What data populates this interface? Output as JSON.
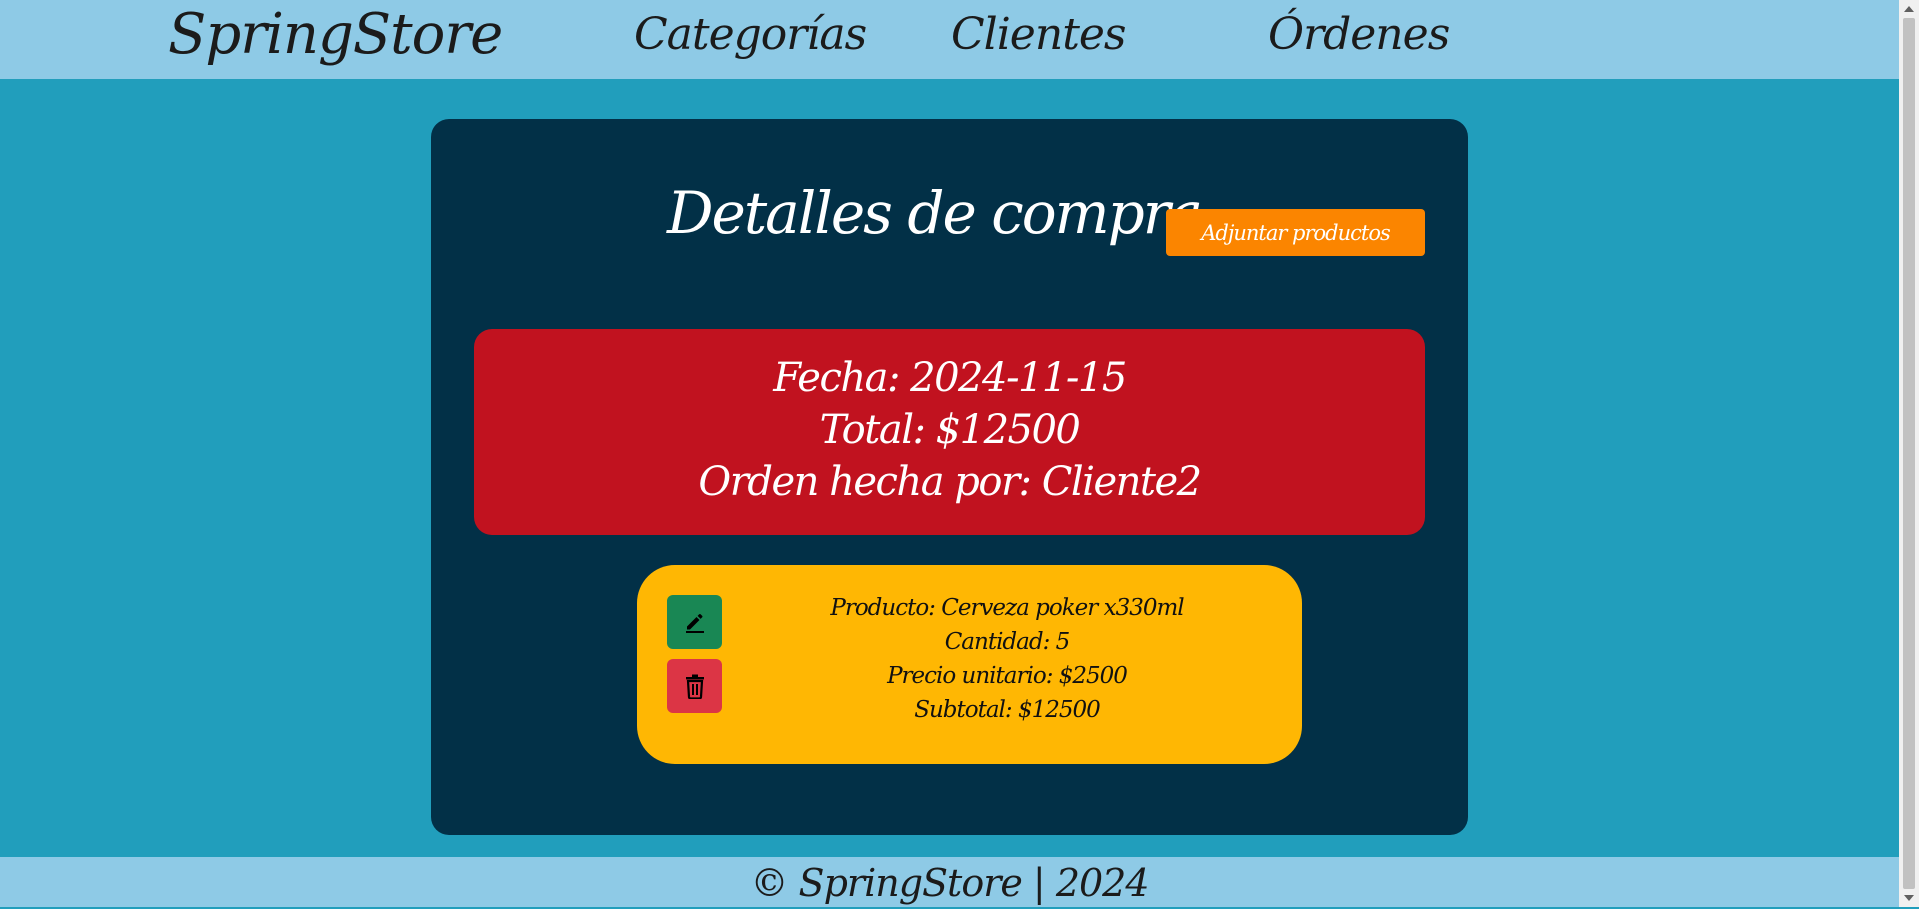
{
  "navbar": {
    "brand": "SpringStore",
    "links": [
      {
        "label": "Categorías"
      },
      {
        "label": "Clientes"
      },
      {
        "label": "Órdenes"
      }
    ]
  },
  "page": {
    "title": "Detalles de compra",
    "attach_button": "Adjuntar productos"
  },
  "order": {
    "fecha": "Fecha: 2024-11-15",
    "total": "Total: $12500",
    "cliente": "Orden hecha por: Cliente2"
  },
  "products": [
    {
      "producto": "Producto: Cerveza poker x330ml",
      "cantidad": "Cantidad: 5",
      "precio": "Precio unitario: $2500",
      "subtotal": "Subtotal: $12500",
      "edit_icon": "pencil-icon",
      "delete_icon": "trash-icon"
    }
  ],
  "footer": {
    "text": "© SpringStore | 2024"
  },
  "colors": {
    "background": "#219ebc",
    "navbar": "#8ecae6",
    "card": "#023047",
    "order_box": "#c1121f",
    "product_card": "#ffb703",
    "attach_button": "#fb8500",
    "edit_button": "#198754",
    "delete_button": "#dc3545"
  }
}
